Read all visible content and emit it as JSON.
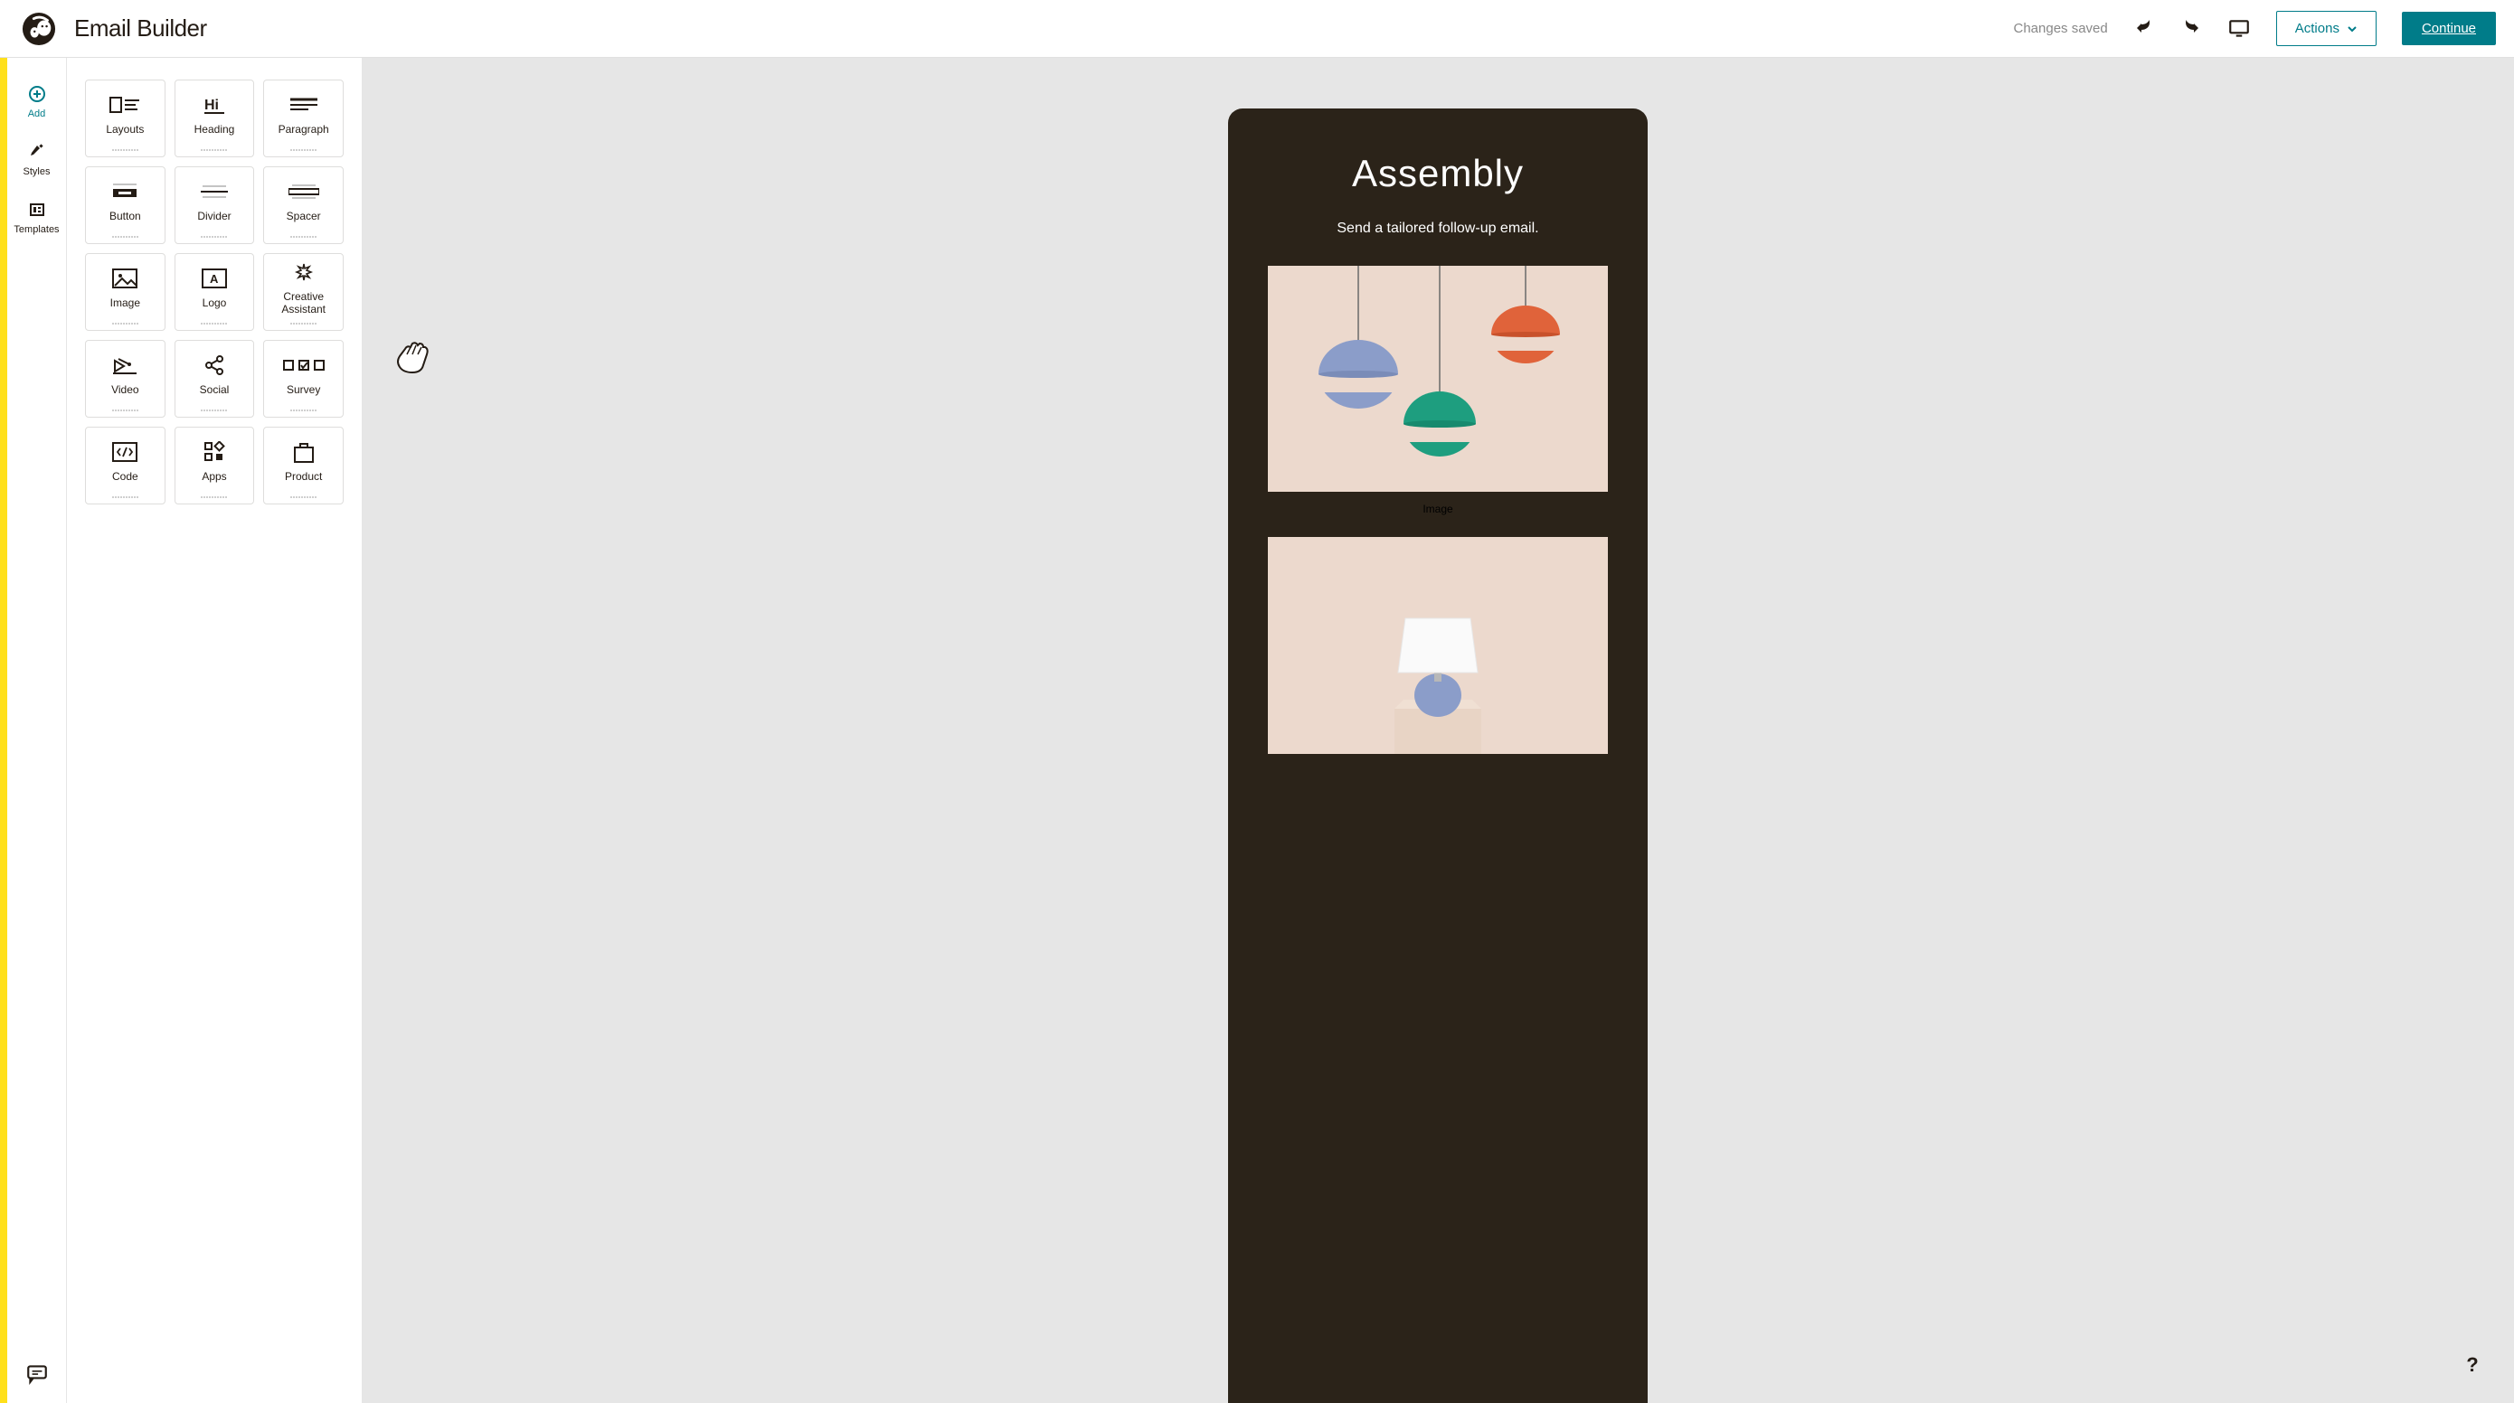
{
  "header": {
    "title": "Email Builder",
    "saved_text": "Changes saved",
    "actions_label": "Actions",
    "continue_label": "Continue"
  },
  "rail": {
    "add": "Add",
    "styles": "Styles",
    "templates": "Templates"
  },
  "blocks": [
    {
      "id": "layouts",
      "label": "Layouts"
    },
    {
      "id": "heading",
      "label": "Heading"
    },
    {
      "id": "paragraph",
      "label": "Paragraph"
    },
    {
      "id": "button",
      "label": "Button"
    },
    {
      "id": "divider",
      "label": "Divider"
    },
    {
      "id": "spacer",
      "label": "Spacer"
    },
    {
      "id": "image",
      "label": "Image"
    },
    {
      "id": "logo",
      "label": "Logo"
    },
    {
      "id": "creative",
      "label": "Creative\nAssistant"
    },
    {
      "id": "video",
      "label": "Video"
    },
    {
      "id": "social",
      "label": "Social"
    },
    {
      "id": "survey",
      "label": "Survey"
    },
    {
      "id": "code",
      "label": "Code"
    },
    {
      "id": "apps",
      "label": "Apps"
    },
    {
      "id": "product",
      "label": "Product"
    }
  ],
  "email": {
    "title": "Assembly",
    "subtitle": "Send a tailored follow-up email.",
    "image_caption": "Image"
  },
  "help_label": "?"
}
